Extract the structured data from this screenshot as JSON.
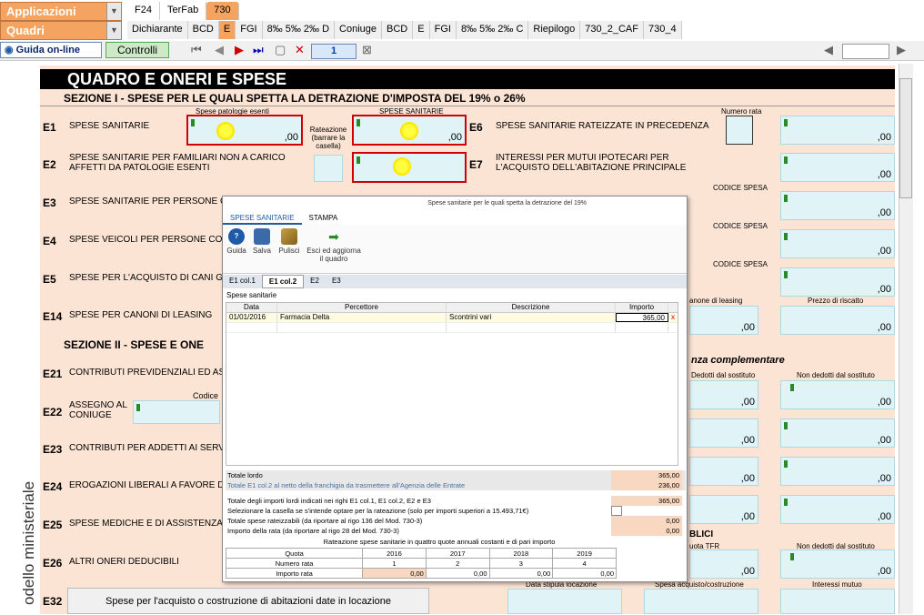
{
  "top": {
    "applicazioni": "Applicazioni",
    "quadri": "Quadri",
    "tabs1": [
      "F24",
      "TerFab",
      "730"
    ],
    "tabs2": [
      "Dichiarante",
      "BCD",
      "E",
      "FGI",
      "8‰ 5‰ 2‰ D",
      "Coniuge",
      "BCD",
      "E",
      "FGI",
      "8‰ 5‰ 2‰ C",
      "Riepilogo",
      "730_2_CAF",
      "730_4"
    ],
    "guida": "Guida on-line",
    "controlli": "Controlli",
    "page": "1"
  },
  "form": {
    "title": "QUADRO   E   ONERI E SPESE",
    "sez1": "SEZIONE I -  SPESE PER LE QUALI SPETTA LA DETRAZIONE D'IMPOSTA DEL 19% o 26%",
    "sez2": "SEZIONE II -  SPESE E ONE",
    "rows": [
      {
        "code": "E1",
        "text": "SPESE SANITARIE"
      },
      {
        "code": "E2",
        "text": "SPESE SANITARIE PER FAMILIARI NON A CARICO AFFETTI DA PATOLOGIE ESENTI"
      },
      {
        "code": "E3",
        "text": "SPESE SANITARIE PER PERSONE C"
      },
      {
        "code": "E4",
        "text": "SPESE VEICOLI PER PERSONE CON"
      },
      {
        "code": "E5",
        "text": "SPESE PER L'ACQUISTO DI CANI GUI"
      },
      {
        "code": "E14",
        "text": "SPESE PER CANONI DI LEASING"
      },
      {
        "code": "E21",
        "text": "CONTRIBUTI PREVIDENZIALI ED ASSI"
      },
      {
        "code": "E22",
        "text": "ASSEGNO AL CONIUGE"
      },
      {
        "code": "E23",
        "text": "CONTRIBUTI PER ADDETTI AI SERVI"
      },
      {
        "code": "E24",
        "text": "EROGAZIONI LIBERALI A FAVORE DI"
      },
      {
        "code": "E25",
        "text": "SPESE MEDICHE E DI ASSISTENZA"
      },
      {
        "code": "E26",
        "text": "ALTRI ONERI DEDUCIBILI"
      },
      {
        "code": "E32",
        "text": ""
      }
    ],
    "e1_lbl1": "Spese patologie esenti",
    "e1_lbl2": "SPESE SANITARIE",
    "rateazione": "Rateazione (barrare la casella)",
    "e6": "SPESE SANITARIE RATEIZZATE IN PRECEDENZA",
    "e7": "INTERESSI PER MUTUI IPOTECARI PER L'ACQUISTO DELL'ABITAZIONE PRINCIPALE",
    "numero_rata": "Numero rata",
    "codice_spesa": "CODICE SPESA",
    "codice": "Codice",
    "zero": ",00",
    "e32_text": "Spese per l'acquisto o costruzione di abitazioni date in locazione",
    "data_stipula": "Data stipula locazione",
    "spesa_acq": "Spesa acquisto/costruzione",
    "interessi_mutuo": "Interessi mutuo",
    "previdenza": "nza complementare",
    "dedotti": "Dedotti dal sostituto",
    "non_dedotti": "Non dedotti dal sostituto",
    "prezzo_riscatto": "Prezzo di riscatto",
    "canone_leasing": "anone di leasing",
    "side": "odello ministeriale"
  },
  "modal": {
    "title": "Spese sanitarie per le quali spetta la detrazione del 19%",
    "ribbon_tabs": [
      "SPESE SANITARIE",
      "STAMPA"
    ],
    "buttons": [
      "Guida",
      "Salva",
      "Pulisci",
      "Esci ed aggiorna il quadro"
    ],
    "subtabs": [
      "E1 col.1",
      "E1 col.2",
      "E2",
      "E3"
    ],
    "section_label": "Spese sanitarie",
    "columns": [
      "Data",
      "Percettore",
      "Descrizione",
      "Importo"
    ],
    "rows": [
      {
        "data": "01/01/2016",
        "percettore": "Farmacia Delta",
        "descrizione": "Scontrini vari",
        "importo": "365,00"
      }
    ],
    "totale_lordo_lbl": "Totale lordo",
    "totale_lordo": "365,00",
    "totale_netto_lbl": "Totale E1 col.2 al netto della franchigia da trasmettere all'Agenzia delle Entrate",
    "totale_netto": "236,00",
    "tot_importi_lbl": "Totale degli importi lordi indicati nei righi E1 col.1, E1 col.2, E2 e E3",
    "tot_importi": "365,00",
    "selez_lbl": "Selezionare la casella se s'intende optare per la rateazione (solo per importi superiori a 15.493,71€)",
    "tot_rate_lbl": "Totale spese rateizzabili (da riportare al rigo 136 del Mod. 730-3)",
    "tot_rate": "0,00",
    "imp_rata_lbl": "Importo della rata (da riportare al rigo 28 del Mod. 730-3)",
    "imp_rata": "0,00",
    "rate_title": "Rateazione spese sanitarie in quattro quote annuali costanti e di pari importo",
    "quota_lbl": "Quota",
    "num_rata_lbl": "Numero rata",
    "imp_rata_row_lbl": "Importo rata",
    "years": [
      "2016",
      "2017",
      "2018",
      "2019"
    ],
    "numbers": [
      "1",
      "2",
      "3",
      "4"
    ],
    "amounts": [
      "0,00",
      "0,00",
      "0,00",
      "0,00"
    ]
  }
}
